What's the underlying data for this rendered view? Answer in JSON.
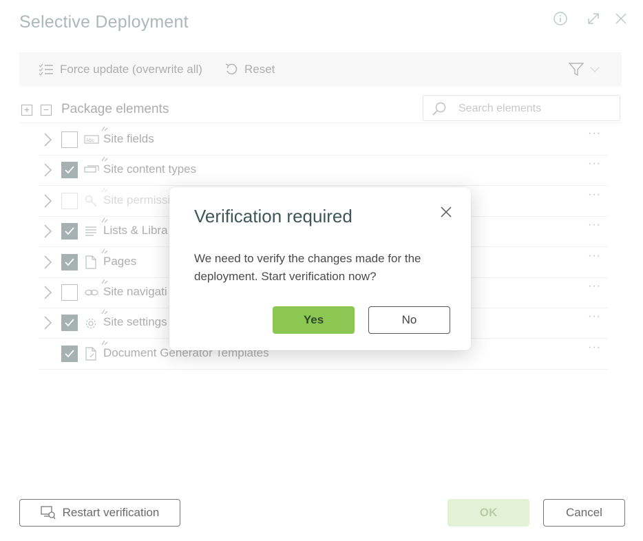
{
  "window": {
    "title": "Selective Deployment",
    "icons": [
      "info-icon",
      "expand-icon",
      "close-icon"
    ]
  },
  "toolbar": {
    "force_update_label": "Force update (overwrite all)",
    "reset_label": "Reset"
  },
  "package": {
    "title": "Package elements",
    "search_placeholder": "Search elements",
    "items": [
      {
        "label": "Site fields",
        "checked": false,
        "disabled": false,
        "icon": "abc-field-icon",
        "expandable": true
      },
      {
        "label": "Site content types",
        "checked": true,
        "disabled": false,
        "icon": "content-type-icon",
        "expandable": true
      },
      {
        "label": "Site permissi",
        "checked": false,
        "disabled": true,
        "icon": "key-icon",
        "expandable": true
      },
      {
        "label": "Lists & Libra",
        "checked": true,
        "disabled": false,
        "icon": "list-icon",
        "expandable": true
      },
      {
        "label": "Pages",
        "checked": true,
        "disabled": false,
        "icon": "page-icon",
        "expandable": true
      },
      {
        "label": "Site navigati",
        "checked": false,
        "disabled": false,
        "icon": "link-icon",
        "expandable": true
      },
      {
        "label": "Site settings",
        "checked": true,
        "disabled": false,
        "icon": "gear-icon",
        "expandable": true
      },
      {
        "label": "Document Generator Templates",
        "checked": true,
        "disabled": false,
        "icon": "document-template-icon",
        "expandable": false
      }
    ],
    "more_label": "···"
  },
  "dialog": {
    "title": "Verification required",
    "message": "We need to verify the changes made for the deployment. Start verification now?",
    "yes_label": "Yes",
    "no_label": "No"
  },
  "footer": {
    "restart_label": "Restart verification",
    "ok_label": "OK",
    "cancel_label": "Cancel"
  }
}
